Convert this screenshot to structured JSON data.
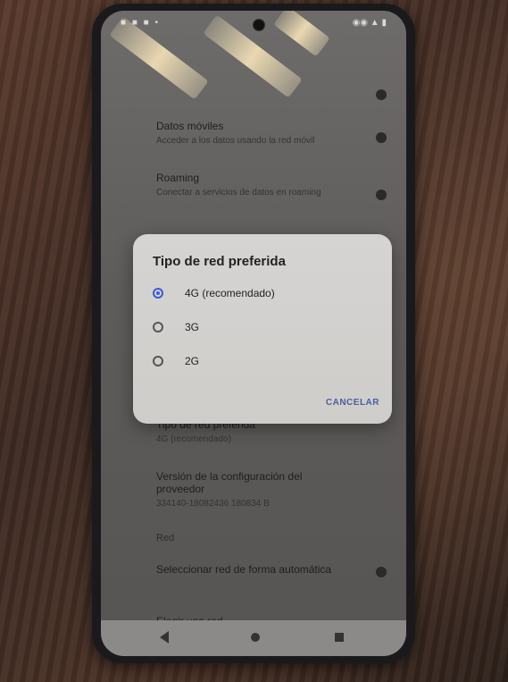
{
  "status_bar": {
    "left_icons": "■ ■ ■ •",
    "right_icons": "◉◉ ▲ ▮"
  },
  "background_settings": [
    {
      "title": "Datos móviles",
      "summary": "Acceder a los datos usando la red móvil",
      "toggle": true
    },
    {
      "title": "Roaming",
      "summary": "Conectar a servicios de datos en roaming",
      "toggle": true
    },
    {
      "title": "Tipo de red preferida",
      "summary": "4G (recomendado)",
      "toggle": false
    },
    {
      "title": "Versión de la configuración del proveedor",
      "summary": "334140-18082436 180834 B",
      "toggle": false
    }
  ],
  "section_red": "Red",
  "auto_network": {
    "title": "Seleccionar red de forma automática",
    "toggle": true
  },
  "partial_item": "Elegir una red",
  "dialog": {
    "title": "Tipo de red preferida",
    "options": [
      {
        "label": "4G (recomendado)",
        "selected": true
      },
      {
        "label": "3G",
        "selected": false
      },
      {
        "label": "2G",
        "selected": false
      }
    ],
    "cancel_label": "CANCELAR",
    "accent_color": "#3b5bdb"
  },
  "nav_bar": {
    "back_icon": "back-icon",
    "home_icon": "home-icon",
    "recents_icon": "recents-icon"
  }
}
